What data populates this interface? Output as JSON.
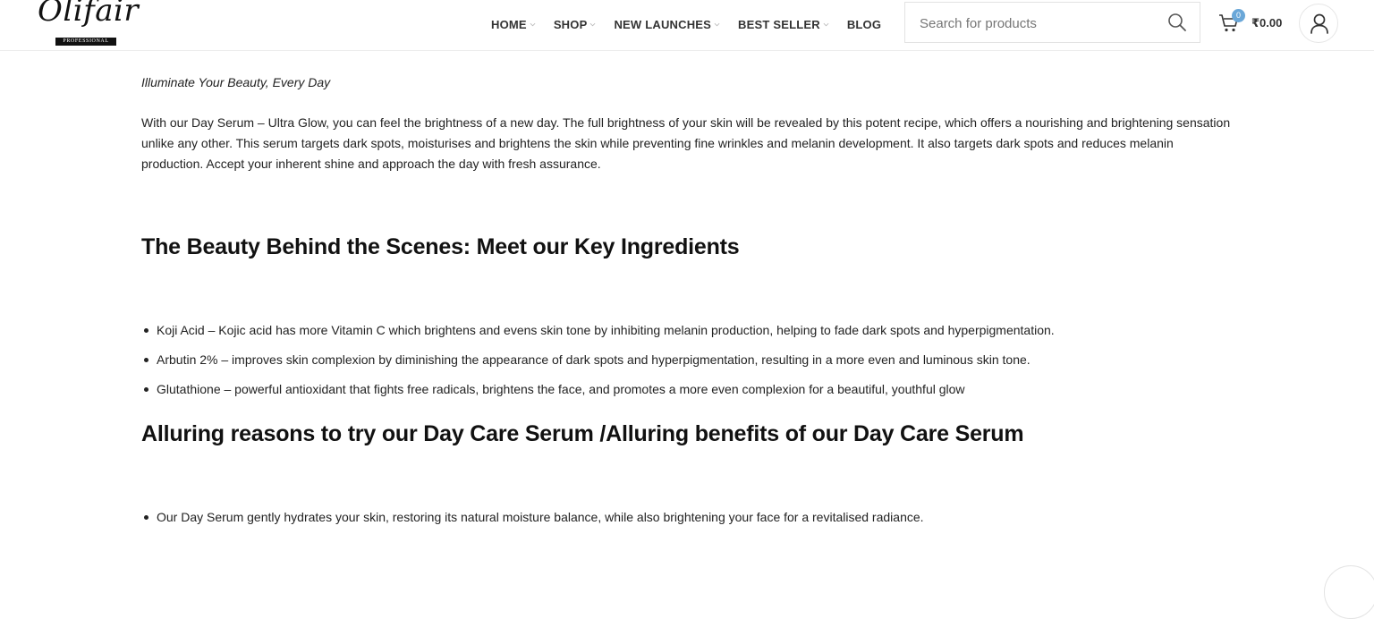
{
  "header": {
    "logo_text": "Olifair",
    "logo_badge": "PROFESSIONAL",
    "nav": [
      {
        "label": "HOME",
        "has_dropdown": true
      },
      {
        "label": "SHOP",
        "has_dropdown": true
      },
      {
        "label": "NEW LAUNCHES",
        "has_dropdown": true
      },
      {
        "label": "BEST SELLER",
        "has_dropdown": true
      },
      {
        "label": "BLOG",
        "has_dropdown": false
      }
    ],
    "search": {
      "placeholder": "Search for products",
      "value": ""
    },
    "cart": {
      "count": "0",
      "total": "₹0.00"
    },
    "icons": {
      "search": "search-icon",
      "cart": "cart-icon",
      "account": "user-icon",
      "dropdown": "chevron-down-icon"
    }
  },
  "content": {
    "tagline": "Illuminate Your Beauty, Every Day",
    "intro": "With our Day Serum – Ultra Glow, you can feel the brightness of a new day. The full brightness of your skin will be revealed by this potent recipe, which offers a nourishing and brightening sensation unlike any other. This serum targets dark spots, moisturises and brightens the skin while preventing fine wrinkles and melanin development. It also targets dark spots and reduces melanin production. Accept your inherent shine and approach the day with fresh assurance.",
    "ingredients_heading": "The Beauty Behind the Scenes: Meet our Key Ingredients",
    "ingredients": [
      "Koji Acid – Kojic acid has more Vitamin C which brightens and evens skin tone by inhibiting melanin production, helping to fade dark spots and hyperpigmentation.",
      "Arbutin 2% – improves skin complexion by diminishing the appearance of dark spots and hyperpigmentation, resulting in a more even and luminous skin tone.",
      "Glutathione – powerful antioxidant that fights free radicals, brightens the face, and promotes a more even complexion for a beautiful, youthful glow"
    ],
    "reasons_heading": "Alluring reasons to try our Day Care Serum /Alluring benefits of our Day Care Serum",
    "reasons": [
      "Our Day Serum gently hydrates your skin, restoring its natural moisture balance, while also brightening your face for a revitalised radiance."
    ]
  },
  "colors": {
    "accent_badge": "#6aa7d8",
    "text": "#222222",
    "border": "#e3e3e3"
  }
}
